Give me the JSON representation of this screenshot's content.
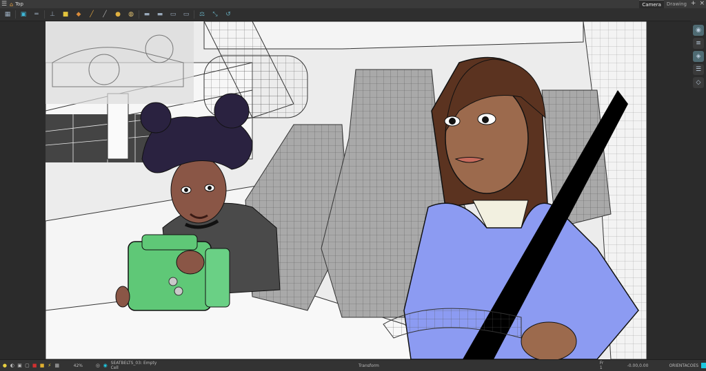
{
  "window": {
    "title": "Top"
  },
  "view_tabs": [
    "Camera",
    "Drawing"
  ],
  "status": {
    "zoom": "42%",
    "layer": "SEATBELTS_03: Empty Cell",
    "mode": "Transform",
    "frame": "Fr 1",
    "coords": "-0.00,0.00",
    "orientation": "ORIENTACOES"
  },
  "colors": {
    "app_bg": "#2b2b2b",
    "accent": "#1ec8e0",
    "shirt_blue": "#8c9bf2",
    "lunchbox_green": "#5fc877"
  },
  "icons": {
    "toolbar": [
      "grid-icon",
      "camera-icon",
      "ruler-icon",
      "anvil-icon",
      "lock-icon",
      "brush-icon",
      "pencil-icon",
      "stamp-icon",
      "palette-icon",
      "shape-icon",
      "transform-icon",
      "flip-icon",
      "align-icon",
      "scale-icon",
      "rotate-icon"
    ],
    "right": [
      "camera-eye-icon",
      "layer-stack-icon",
      "cube-icon",
      "layers-icon",
      "object-icon"
    ]
  }
}
